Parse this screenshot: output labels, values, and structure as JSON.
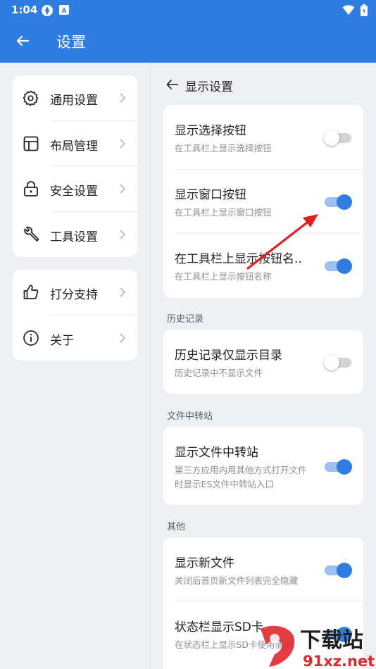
{
  "status_bar": {
    "time": "1:04"
  },
  "app_bar": {
    "title": "设置"
  },
  "menu": {
    "group1": [
      {
        "label": "通用设置",
        "icon": "gear-icon"
      },
      {
        "label": "布局管理",
        "icon": "layout-icon"
      },
      {
        "label": "安全设置",
        "icon": "lock-icon"
      },
      {
        "label": "工具设置",
        "icon": "wrench-icon"
      }
    ],
    "group2": [
      {
        "label": "打分支持",
        "icon": "thumbs-up-icon"
      },
      {
        "label": "关于",
        "icon": "info-icon"
      }
    ]
  },
  "panel": {
    "title": "显示设置",
    "card1": [
      {
        "title": "显示选择按钮",
        "subtitle": "在工具栏上显示选择按钮",
        "enabled": false
      },
      {
        "title": "显示窗口按钮",
        "subtitle": "在工具栏上显示窗口按钮",
        "enabled": true
      },
      {
        "title": "在工具栏上显示按钮名..",
        "subtitle": "在工具栏上显示按钮名称",
        "enabled": true
      }
    ],
    "history": {
      "label": "历史记录",
      "items": [
        {
          "title": "历史记录仅显示目录",
          "subtitle": "历史记录中不显示文件",
          "enabled": false
        }
      ]
    },
    "transfer": {
      "label": "文件中转站",
      "items": [
        {
          "title": "显示文件中转站",
          "subtitle": "第三方应用内用其他方式打开文件时显示ES文件中转站入口",
          "enabled": true
        }
      ]
    },
    "other": {
      "label": "其他",
      "items": [
        {
          "title": "显示新文件",
          "subtitle": "关闭后首页新文件列表完全隐藏",
          "enabled": true
        },
        {
          "title": "状态栏显示SD卡",
          "subtitle": "在状态栏上显示SD卡使用情况",
          "enabled": true
        }
      ]
    }
  },
  "watermark": {
    "text": "下载站",
    "domain": "91xz.net"
  },
  "colors": {
    "accent": "#2f7de1",
    "toggle_track_on": "#9cc0f2",
    "annotation_arrow": "#e02020"
  }
}
